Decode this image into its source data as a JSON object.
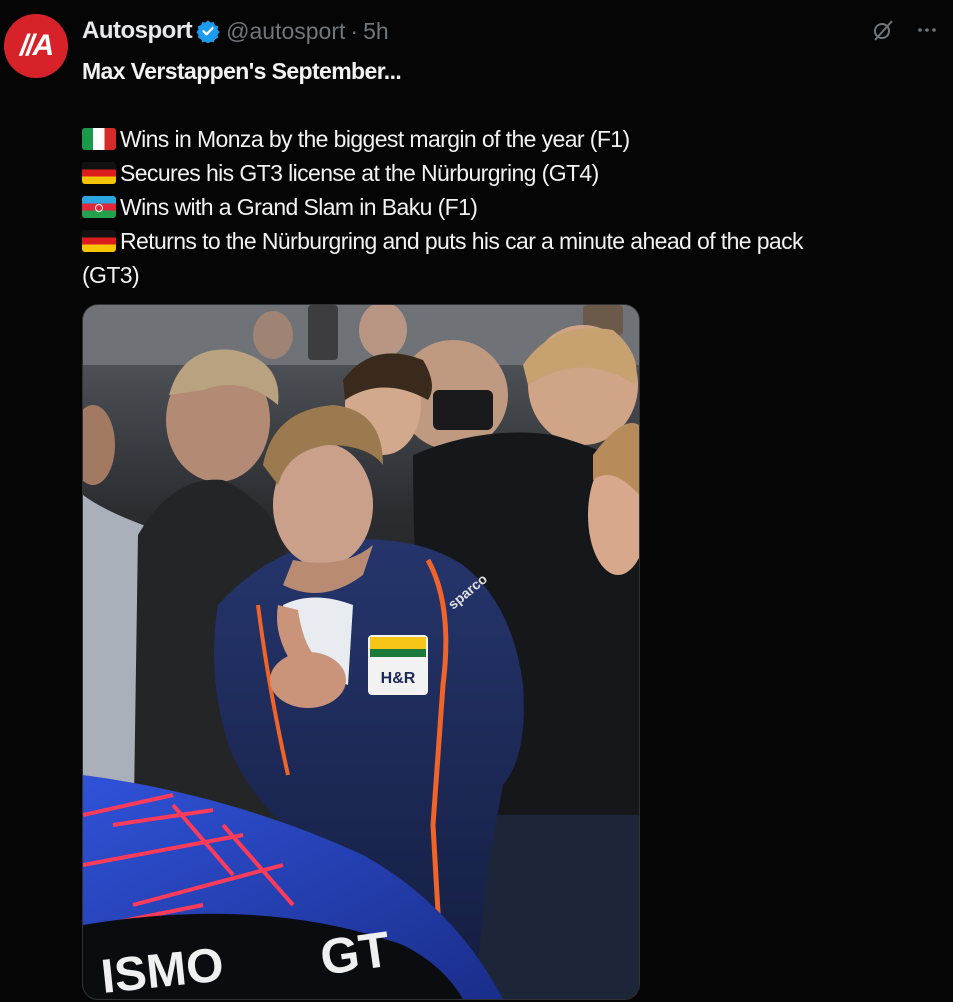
{
  "author": {
    "display_name": "Autosport",
    "handle": "@autosport",
    "separator": "·",
    "timestamp": "5h",
    "avatar_text": "A",
    "verified": true
  },
  "icons": {
    "verified": "verified-badge-icon",
    "grok": "grok-icon",
    "more": "more-options-icon"
  },
  "text": {
    "headline": "Max Verstappen's September...",
    "lines": [
      {
        "flag": "italy-flag",
        "text": "Wins in Monza by the biggest margin of the year (F1)"
      },
      {
        "flag": "germany-flag",
        "text": "Secures his GT3 license at the Nürburgring (GT4)"
      },
      {
        "flag": "azerbaijan-flag",
        "text": "Wins with a Grand Slam in Baku (F1)"
      },
      {
        "flag": "germany-flag",
        "text": "Returns to the Nürburgring and puts his car a minute ahead of the pack"
      }
    ],
    "continuation": "(GT3)"
  },
  "media": {
    "car_text_left": "ISMO",
    "car_text_right": "GT",
    "suit_sponsor": "H&R",
    "suit_text": "sparco",
    "colors": {
      "suit": "#1d2a5a",
      "suit_stripe": "#f0642a",
      "car_body": "#2543c7",
      "car_lines": "#ff3b5a"
    }
  },
  "colors": {
    "background": "#050505",
    "text": "#e7e9ea",
    "secondary": "#71767b",
    "verified": "#1d9bf0",
    "brand": "#d8222a"
  }
}
